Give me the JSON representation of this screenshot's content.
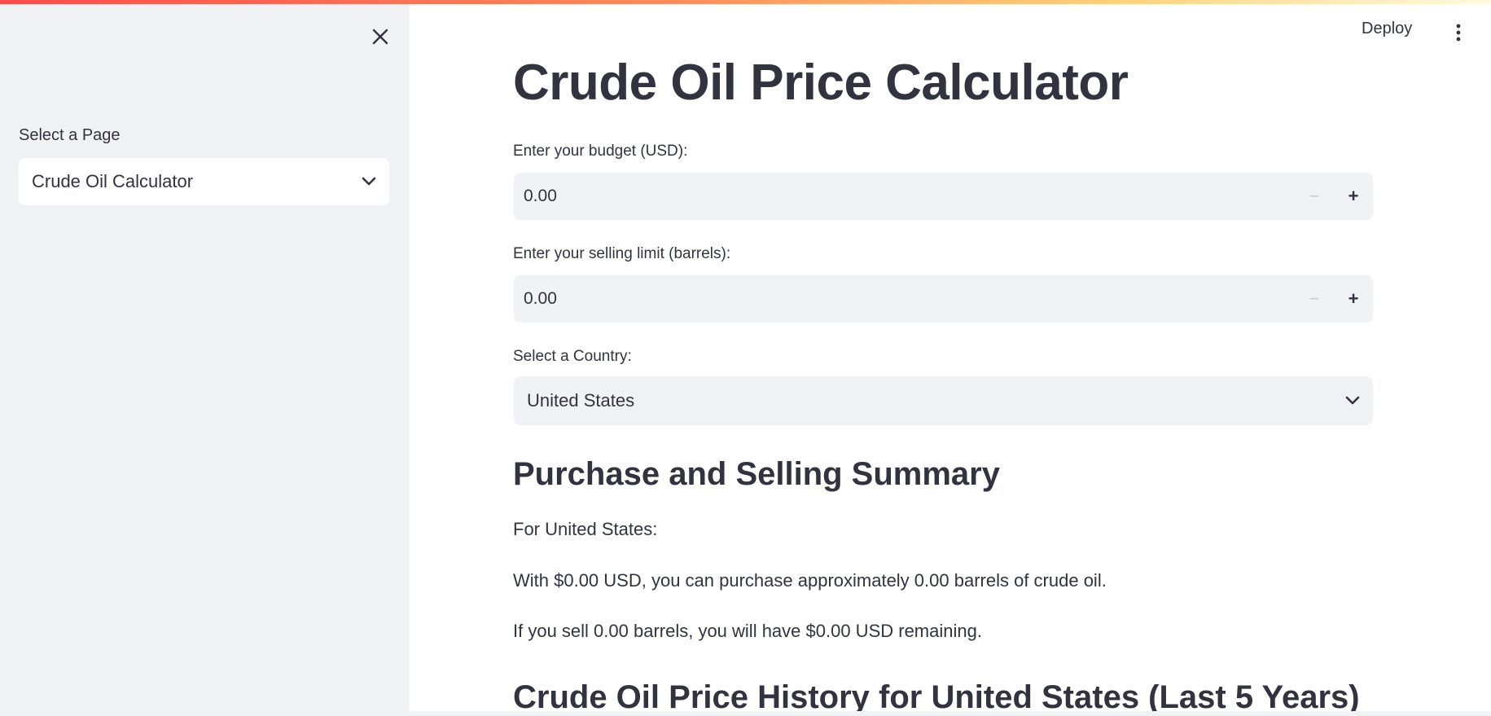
{
  "header": {
    "deploy_label": "Deploy",
    "menu_icon": "kebab-menu-icon"
  },
  "sidebar": {
    "close_icon": "close-icon",
    "select_label": "Select a Page",
    "select_value": "Crude Oil Calculator",
    "chevron_icon": "chevron-down-icon"
  },
  "main": {
    "title": "Crude Oil Price Calculator",
    "budget": {
      "label": "Enter your budget (USD):",
      "value": "0.00",
      "minus": "−",
      "plus": "+"
    },
    "selling_limit": {
      "label": "Enter your selling limit (barrels):",
      "value": "0.00",
      "minus": "−",
      "plus": "+"
    },
    "country": {
      "label": "Select a Country:",
      "value": "United States"
    },
    "summary": {
      "heading": "Purchase and Selling Summary",
      "line1": "For United States:",
      "line2": "With $0.00 USD, you can purchase approximately 0.00 barrels of crude oil.",
      "line3": "If you sell 0.00 barrels, you will have $0.00 USD remaining."
    },
    "history_heading": "Crude Oil Price History for United States (Last 5 Years)"
  },
  "colors": {
    "accent_gradient_start": "#ff4b4b",
    "accent_gradient_end": "#fffae0",
    "sidebar_bg": "#f0f2f6",
    "text": "#31333f"
  }
}
